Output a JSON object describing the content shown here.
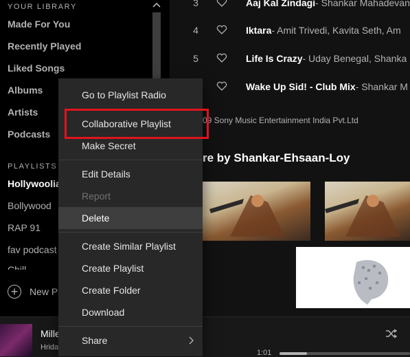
{
  "sidebar": {
    "library_heading": "YOUR LIBRARY",
    "library_items": [
      "Made For You",
      "Recently Played",
      "Liked Songs",
      "Albums",
      "Artists",
      "Podcasts"
    ],
    "playlists_heading": "PLAYLISTS",
    "playlists": [
      "Hollywoolia",
      "Bollywood",
      "RAP 91",
      "fav podcast",
      "Chill"
    ],
    "new_playlist_label": "New P"
  },
  "tracks": [
    {
      "num": "3",
      "title": "Aaj Kal Zindagi",
      "artist": " - Shankar Mahadevan"
    },
    {
      "num": "4",
      "title": "Iktara",
      "artist": " - Amit Trivedi, Kavita Seth, Am"
    },
    {
      "num": "5",
      "title": "Life Is Crazy",
      "artist": " - Uday Benegal, Shanka"
    },
    {
      "num": "",
      "title": "Wake Up Sid! - Club Mix",
      "artist": " - Shankar M"
    }
  ],
  "copyright": "09 Sony Music Entertainment India Pvt.Ltd",
  "more_by": "re by Shankar-Ehsaan-Loy",
  "context_menu": {
    "items": [
      {
        "label": "Go to Playlist Radio",
        "state": "normal"
      },
      {
        "label": "Collaborative Playlist",
        "state": "normal"
      },
      {
        "label": "Make Secret",
        "state": "normal"
      },
      {
        "label": "Edit Details",
        "state": "normal"
      },
      {
        "label": "Report",
        "state": "disabled"
      },
      {
        "label": "Delete",
        "state": "hover"
      },
      {
        "label": "Create Similar Playlist",
        "state": "normal"
      },
      {
        "label": "Create Playlist",
        "state": "normal"
      },
      {
        "label": "Create Folder",
        "state": "normal"
      },
      {
        "label": "Download",
        "state": "normal"
      },
      {
        "label": "Share",
        "state": "normal"
      }
    ]
  },
  "now_playing": {
    "title": "Mille",
    "artist": "Hrida",
    "elapsed": "1:01",
    "progress_fraction": 0.21
  },
  "colors": {
    "highlight_box": "#e0141e",
    "menu_bg": "#282828",
    "sidebar_bg": "#000000"
  },
  "icons": [
    "chevron-up-icon",
    "heart-icon",
    "plus-icon",
    "chevron-right-icon",
    "shuffle-icon"
  ]
}
